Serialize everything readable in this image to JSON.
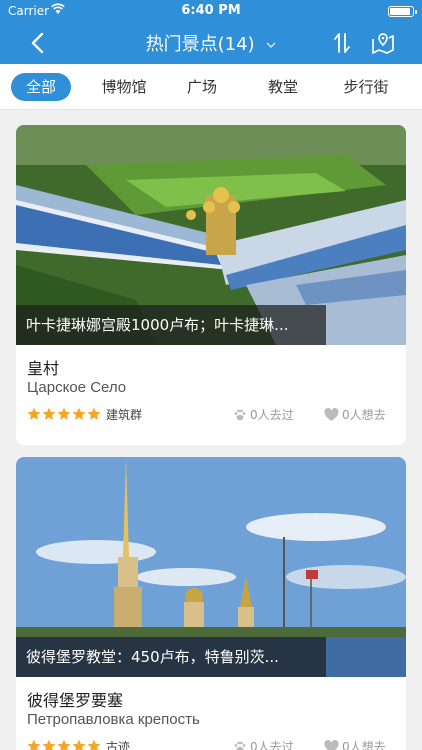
{
  "status_bar": {
    "carrier": "Carrier",
    "time": "6:40 PM",
    "battery_level": 0.9
  },
  "nav": {
    "title": "热门景点(14)",
    "icons": [
      "back-icon",
      "chevron-down-icon",
      "sort-icon",
      "map-icon"
    ]
  },
  "tabs": [
    {
      "label": "全部",
      "active": true
    },
    {
      "label": "博物馆",
      "active": false
    },
    {
      "label": "广场",
      "active": false
    },
    {
      "label": "教堂",
      "active": false
    },
    {
      "label": "步行街",
      "active": false
    }
  ],
  "cards": [
    {
      "caption": "叶卡捷琳娜宫殿1000卢布；叶卡捷琳...",
      "name_cn": "皇村",
      "name_ru": "Царское Село",
      "rating": 5,
      "category": "建筑群",
      "visited": "0人去过",
      "want": "0人想去"
    },
    {
      "caption": "彼得堡罗教堂：450卢布，特鲁别茨...",
      "name_cn": "彼得堡罗要塞",
      "name_ru": "Петропавловка крепость",
      "rating": 5,
      "category": "古迹",
      "visited": "0人去过",
      "want": "0人想去"
    }
  ],
  "colors": {
    "primary": "#2f8fd8",
    "star": "#f5a623"
  }
}
